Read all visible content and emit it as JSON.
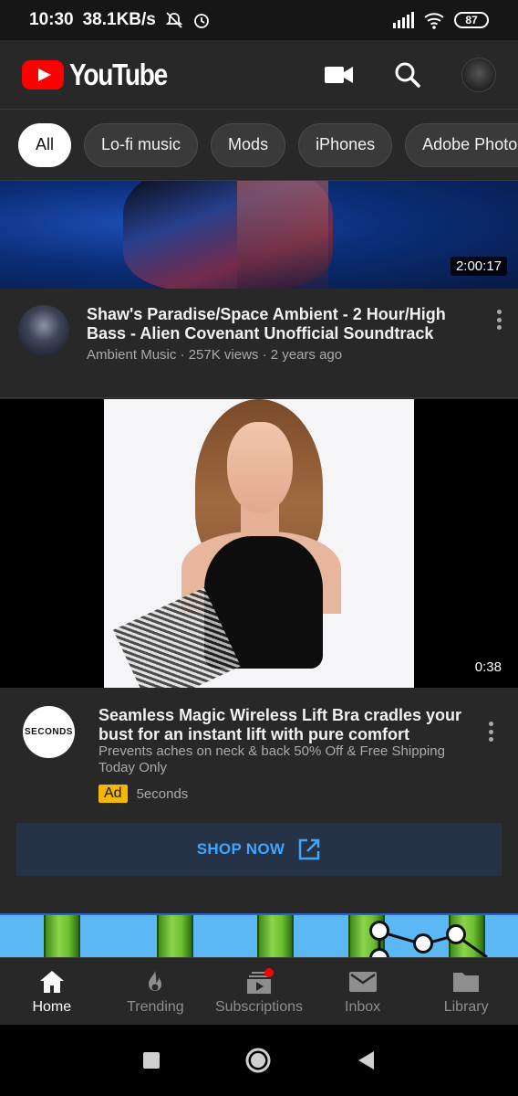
{
  "status_bar": {
    "time": "10:30",
    "speed": "38.1KB/s",
    "battery": "87",
    "icons": [
      "mute-icon",
      "alarm-icon",
      "signal-icon",
      "wifi-icon",
      "battery-icon"
    ]
  },
  "header": {
    "logo_text": "YouTube",
    "actions": [
      "camera-icon",
      "search-icon",
      "account-avatar"
    ]
  },
  "chips": [
    {
      "label": "All",
      "active": true
    },
    {
      "label": "Lo-fi music",
      "active": false
    },
    {
      "label": "Mods",
      "active": false
    },
    {
      "label": "iPhones",
      "active": false
    },
    {
      "label": "Adobe Photosh",
      "active": false
    }
  ],
  "videos": [
    {
      "duration": "2:00:17",
      "title": "Shaw's Paradise/Space Ambient - 2 Hour/High Bass - Alien Covenant Unofficial Soundtrack",
      "channel": "Ambient Music",
      "views": "257K views",
      "age": "2 years ago",
      "subtitle": "Ambient Music · 257K views · 2 years ago"
    }
  ],
  "ad": {
    "duration": "0:38",
    "avatar_text": "SECONDS",
    "title": "Seamless Magic Wireless Lift Bra cradles your bust for an instant lift with pure comfort",
    "description": "Prevents aches on neck & back 50% Off & Free Shipping Today Only",
    "badge": "Ad",
    "advertiser": "5econds",
    "cta": "SHOP NOW"
  },
  "bottom_nav": [
    {
      "label": "Home",
      "icon": "home-icon",
      "active": true
    },
    {
      "label": "Trending",
      "icon": "flame-icon",
      "active": false
    },
    {
      "label": "Subscriptions",
      "icon": "subscriptions-icon",
      "active": false
    },
    {
      "label": "Inbox",
      "icon": "mail-icon",
      "active": false
    },
    {
      "label": "Library",
      "icon": "folder-icon",
      "active": false
    }
  ],
  "colors": {
    "brand_red": "#ff0000",
    "background": "#282828",
    "link_blue": "#3ea6ff",
    "ad_badge": "#f5b800"
  }
}
